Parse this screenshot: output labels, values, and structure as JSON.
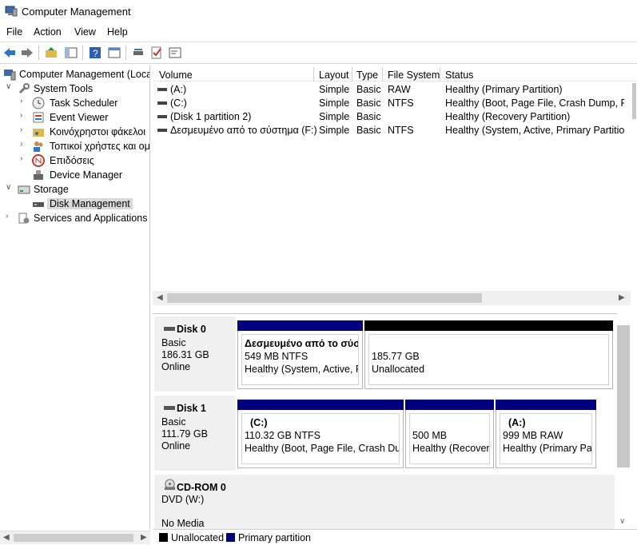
{
  "window": {
    "title": "Computer Management"
  },
  "menu": [
    "File",
    "Action",
    "View",
    "Help"
  ],
  "toolbar": {
    "icons": [
      "back-icon",
      "forward-icon",
      "up-folder-icon",
      "show-hide-tree-icon",
      "help-icon",
      "properties-icon",
      "disk-connect-icon",
      "check-icon",
      "console-icon"
    ]
  },
  "tree": {
    "root": "Computer Management (Local",
    "system_tools": "System Tools",
    "task_scheduler": "Task Scheduler",
    "event_viewer": "Event Viewer",
    "shared_folders": "Κοινόχρηστοι φάκελοι",
    "local_users": "Τοπικοί χρήστες και ομ",
    "performance": "Επιδόσεις",
    "device_manager": "Device Manager",
    "storage": "Storage",
    "disk_management": "Disk Management",
    "services": "Services and Applications"
  },
  "volumes": {
    "columns": [
      "Volume",
      "Layout",
      "Type",
      "File System",
      "Status"
    ],
    "rows": [
      {
        "volume": "(A:)",
        "layout": "Simple",
        "type": "Basic",
        "fs": "RAW",
        "status": "Healthy (Primary Partition)"
      },
      {
        "volume": "(C:)",
        "layout": "Simple",
        "type": "Basic",
        "fs": "NTFS",
        "status": "Healthy (Boot, Page File, Crash Dump, Prim"
      },
      {
        "volume": "(Disk 1 partition 2)",
        "layout": "Simple",
        "type": "Basic",
        "fs": "",
        "status": "Healthy (Recovery Partition)"
      },
      {
        "volume": "Δεσμευμένο από το σύστημα (F:)",
        "layout": "Simple",
        "type": "Basic",
        "fs": "NTFS",
        "status": "Healthy (System, Active, Primary Partition)"
      }
    ]
  },
  "disks": [
    {
      "name": "Disk 0",
      "kind": "Basic",
      "size": "186.31 GB",
      "state": "Online",
      "partitions": [
        {
          "label": "Δεσμευμένο από το σύστ",
          "size": "549 MB NTFS",
          "status": "Healthy (System, Active, Pri"
        },
        {
          "label": "",
          "size": "185.77 GB",
          "status": "Unallocated"
        }
      ]
    },
    {
      "name": "Disk 1",
      "kind": "Basic",
      "size": "111.79 GB",
      "state": "Online",
      "partitions": [
        {
          "label": "(C:)",
          "size": "110.32 GB NTFS",
          "status": "Healthy (Boot, Page File, Crash Dump"
        },
        {
          "label": "",
          "size": "500 MB",
          "status": "Healthy (Recovery"
        },
        {
          "label": "(A:)",
          "size": "999 MB RAW",
          "status": "Healthy (Primary Part"
        }
      ]
    },
    {
      "name": "CD-ROM 0",
      "kind": "DVD (W:)",
      "media": "No Media"
    }
  ],
  "legend": {
    "unallocated": "Unallocated",
    "primary": "Primary partition"
  },
  "colors": {
    "primary": "#00007f",
    "unallocated": "#000000"
  }
}
